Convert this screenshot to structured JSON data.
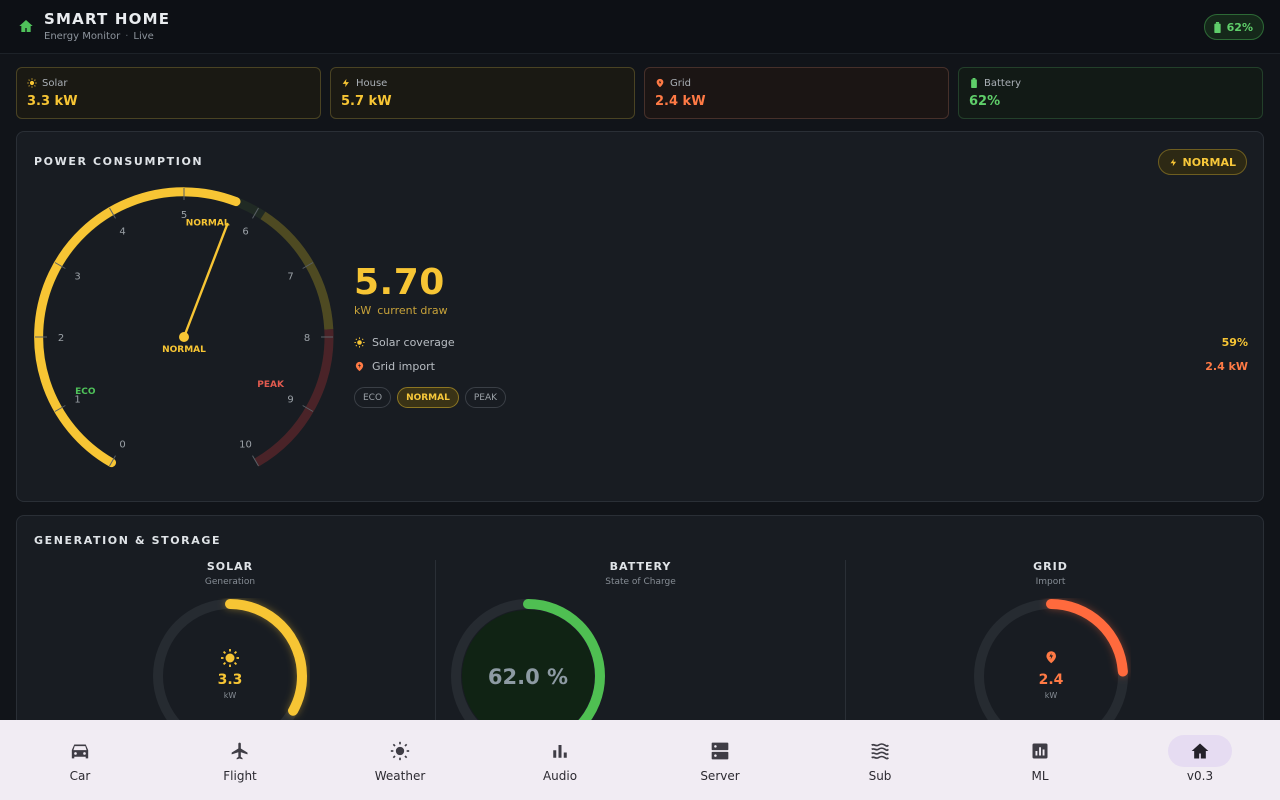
{
  "header": {
    "title": "SMART HOME",
    "subtitle": "Energy Monitor",
    "status": "Live",
    "battery_badge": "62%"
  },
  "stats": [
    {
      "label": "Solar",
      "value": "3.3 kW",
      "icon": "sun-icon",
      "color": "#f7c534"
    },
    {
      "label": "House",
      "value": "5.7 kW",
      "icon": "bolt-icon",
      "color": "#f7c534"
    },
    {
      "label": "Grid",
      "value": "2.4 kW",
      "icon": "grid-pin-icon",
      "color": "#ff7a45"
    },
    {
      "label": "Battery",
      "value": "62%",
      "icon": "battery-icon",
      "color": "#5fcf6a"
    }
  ],
  "power": {
    "title": "POWER CONSUMPTION",
    "mode_badge": "NORMAL",
    "value": "5.70",
    "unit": "kW",
    "unit_label": "current draw",
    "gauge": {
      "min": 0,
      "max": 10,
      "value": 5.7,
      "ticks": [
        "0",
        "1",
        "2",
        "3",
        "4",
        "5",
        "6",
        "7",
        "8",
        "9",
        "10"
      ],
      "zone_labels": {
        "eco": "ECO",
        "normal": "NORMAL",
        "peak": "PEAK"
      },
      "needle_label": "NORMAL"
    },
    "rows": [
      {
        "label": "Solar coverage",
        "value": "59%",
        "icon": "sun-icon",
        "color": "#f7c534"
      },
      {
        "label": "Grid import",
        "value": "2.4 kW",
        "icon": "grid-pin-icon",
        "color": "#ff7a45"
      }
    ],
    "chips": [
      {
        "label": "ECO",
        "active": false
      },
      {
        "label": "NORMAL",
        "active": true
      },
      {
        "label": "PEAK",
        "active": false
      }
    ]
  },
  "generation": {
    "title": "GENERATION & STORAGE",
    "columns": [
      {
        "title": "SOLAR",
        "subtitle": "Generation",
        "value": "3.3",
        "unit": "kW",
        "fraction": 0.33,
        "color": "#f7c534"
      },
      {
        "title": "BATTERY",
        "subtitle": "State of Charge",
        "value": "62.0 %",
        "fraction": 0.62,
        "color": "#4fbf52"
      },
      {
        "title": "GRID",
        "subtitle": "Import",
        "value": "2.4",
        "unit": "kW",
        "fraction": 0.24,
        "color": "#ff6a3d"
      }
    ]
  },
  "nav": [
    {
      "label": "Car",
      "icon": "car-icon"
    },
    {
      "label": "Flight",
      "icon": "airplane-icon"
    },
    {
      "label": "Weather",
      "icon": "sun-icon"
    },
    {
      "label": "Audio",
      "icon": "bar-chart-icon"
    },
    {
      "label": "Server",
      "icon": "server-icon"
    },
    {
      "label": "Sub",
      "icon": "waves-icon"
    },
    {
      "label": "ML",
      "icon": "analytics-icon"
    },
    {
      "label": "v0.3",
      "icon": "home-icon",
      "active": true
    }
  ]
}
